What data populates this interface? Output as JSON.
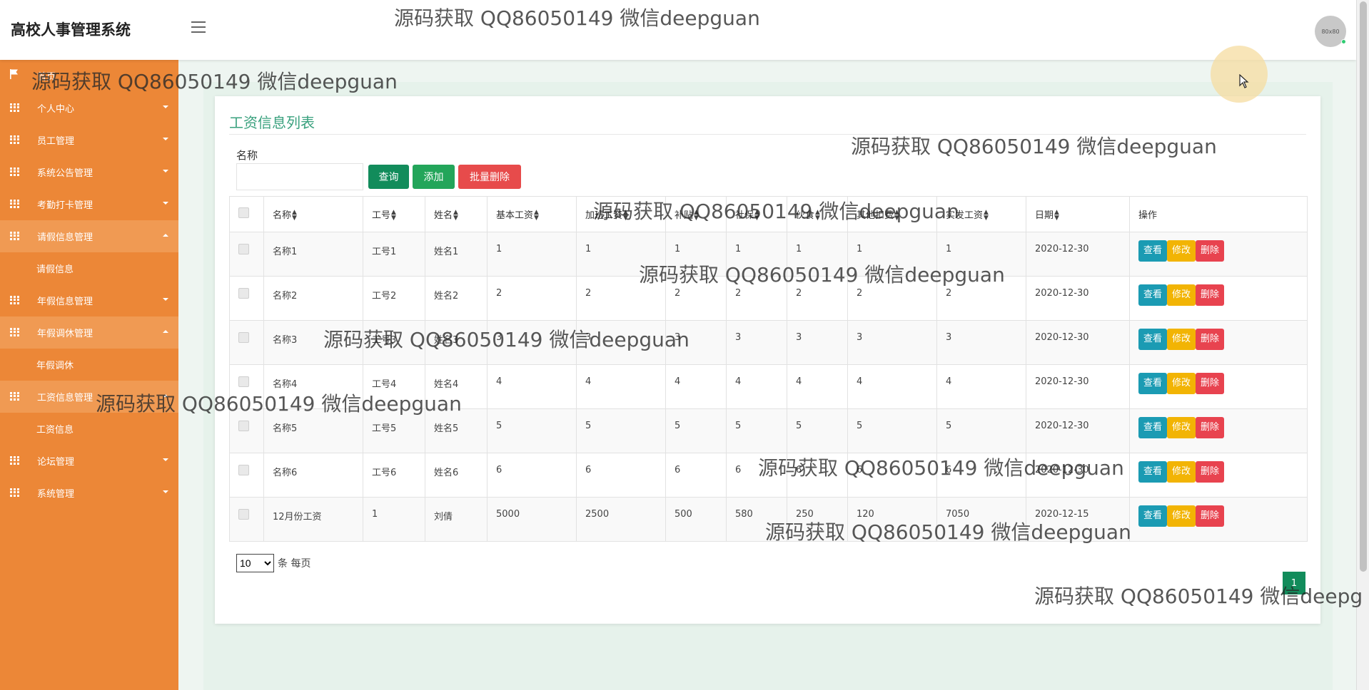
{
  "header": {
    "app_title": "高校人事管理系统",
    "avatar_text": "80x80"
  },
  "sidebar": {
    "items": [
      {
        "label": "首页",
        "icon": "flag-icon"
      },
      {
        "label": "个人中心",
        "icon": "grid-icon"
      },
      {
        "label": "员工管理",
        "icon": "grid-icon"
      },
      {
        "label": "系统公告管理",
        "icon": "grid-icon"
      },
      {
        "label": "考勤打卡管理",
        "icon": "grid-icon"
      },
      {
        "label": "请假信息管理",
        "icon": "grid-icon",
        "open": true,
        "sub": "请假信息"
      },
      {
        "label": "年假信息管理",
        "icon": "grid-icon"
      },
      {
        "label": "年假调休管理",
        "icon": "grid-icon",
        "open": true,
        "sub": "年假调休"
      },
      {
        "label": "工资信息管理",
        "icon": "grid-icon",
        "open": true,
        "sub": "工资信息"
      },
      {
        "label": "论坛管理",
        "icon": "grid-icon"
      },
      {
        "label": "系统管理",
        "icon": "grid-icon"
      }
    ]
  },
  "main": {
    "title": "工资信息列表",
    "search": {
      "label": "名称",
      "value": "",
      "placeholder": ""
    },
    "buttons": {
      "query": "查询",
      "add": "添加",
      "batch_delete": "批量删除"
    },
    "table": {
      "columns": [
        "名称",
        "工号",
        "姓名",
        "基本工资",
        "加班工资",
        "补贴",
        "社保",
        "伙食",
        "其他扣费",
        "实发工资",
        "日期",
        "操作"
      ],
      "rows": [
        [
          "名称1",
          "工号1",
          "姓名1",
          "1",
          "1",
          "1",
          "1",
          "1",
          "1",
          "1",
          "2020-12-30"
        ],
        [
          "名称2",
          "工号2",
          "姓名2",
          "2",
          "2",
          "2",
          "2",
          "2",
          "2",
          "2",
          "2020-12-30"
        ],
        [
          "名称3",
          "工号3",
          "姓名3",
          "3",
          "3",
          "3",
          "3",
          "3",
          "3",
          "3",
          "2020-12-30"
        ],
        [
          "名称4",
          "工号4",
          "姓名4",
          "4",
          "4",
          "4",
          "4",
          "4",
          "4",
          "4",
          "2020-12-30"
        ],
        [
          "名称5",
          "工号5",
          "姓名5",
          "5",
          "5",
          "5",
          "5",
          "5",
          "5",
          "5",
          "2020-12-30"
        ],
        [
          "名称6",
          "工号6",
          "姓名6",
          "6",
          "6",
          "6",
          "6",
          "6",
          "6",
          "6",
          "2020-12-30"
        ],
        [
          "12月份工资",
          "1",
          "刘倩",
          "5000",
          "2500",
          "500",
          "580",
          "250",
          "120",
          "7050",
          "2020-12-15"
        ]
      ],
      "actions": {
        "view": "查看",
        "edit": "修改",
        "delete": "删除"
      }
    },
    "pagination": {
      "page_size": "10",
      "page_size_suffix": "条 每页",
      "current_page": "1"
    }
  },
  "watermark": {
    "text": "源码获取 QQ86050149 微信deepguan",
    "cut_text": "源码获取 QQ86050149 微信deepg"
  },
  "colors": {
    "sidebar": "#ec8737",
    "accent_green": "#128c5b",
    "title_green": "#3aa17e",
    "danger": "#e74b4b",
    "view": "#1b9bb3",
    "edit": "#f2b404"
  }
}
